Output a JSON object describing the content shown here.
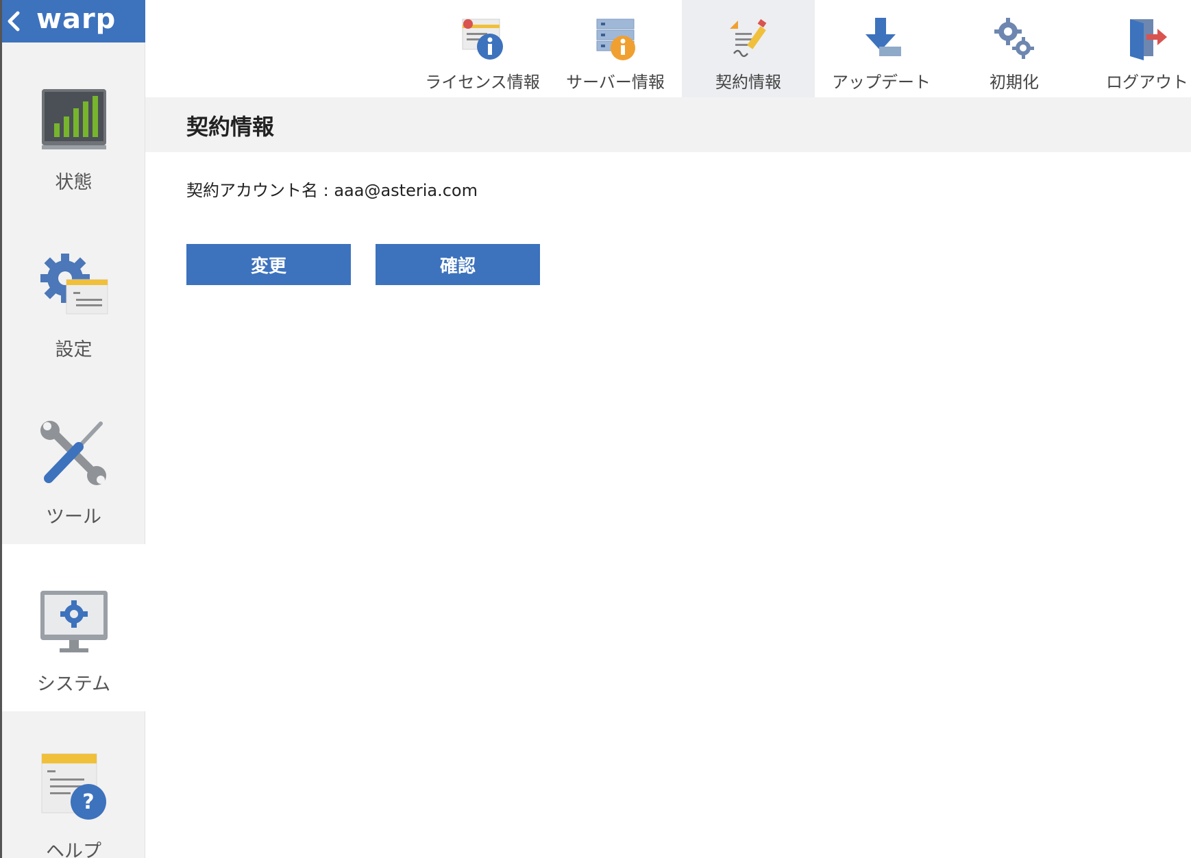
{
  "app": {
    "logo": "warp"
  },
  "sidebar": {
    "items": [
      {
        "label": "状態",
        "icon": "bar-chart-icon"
      },
      {
        "label": "設定",
        "icon": "settings-gear-icon"
      },
      {
        "label": "ツール",
        "icon": "tools-icon"
      },
      {
        "label": "システム",
        "icon": "system-monitor-icon",
        "active": true
      },
      {
        "label": "ヘルプ",
        "icon": "help-document-icon"
      }
    ]
  },
  "topnav": {
    "items": [
      {
        "label": "ライセンス情報",
        "icon": "license-info-icon"
      },
      {
        "label": "サーバー情報",
        "icon": "server-info-icon"
      },
      {
        "label": "契約情報",
        "icon": "contract-edit-icon",
        "active": true
      },
      {
        "label": "アップデート",
        "icon": "update-download-icon"
      },
      {
        "label": "初期化",
        "icon": "initialize-gears-icon"
      },
      {
        "label": "ログアウト",
        "icon": "logout-icon"
      }
    ]
  },
  "page": {
    "title": "契約情報",
    "account_line": "契約アカウント名 : aaa@asteria.com",
    "buttons": {
      "change": "変更",
      "confirm": "確認"
    }
  },
  "colors": {
    "accent": "#3d72bd",
    "sidebar_bg": "#f2f2f2",
    "header_bg": "#f2f2f2"
  }
}
